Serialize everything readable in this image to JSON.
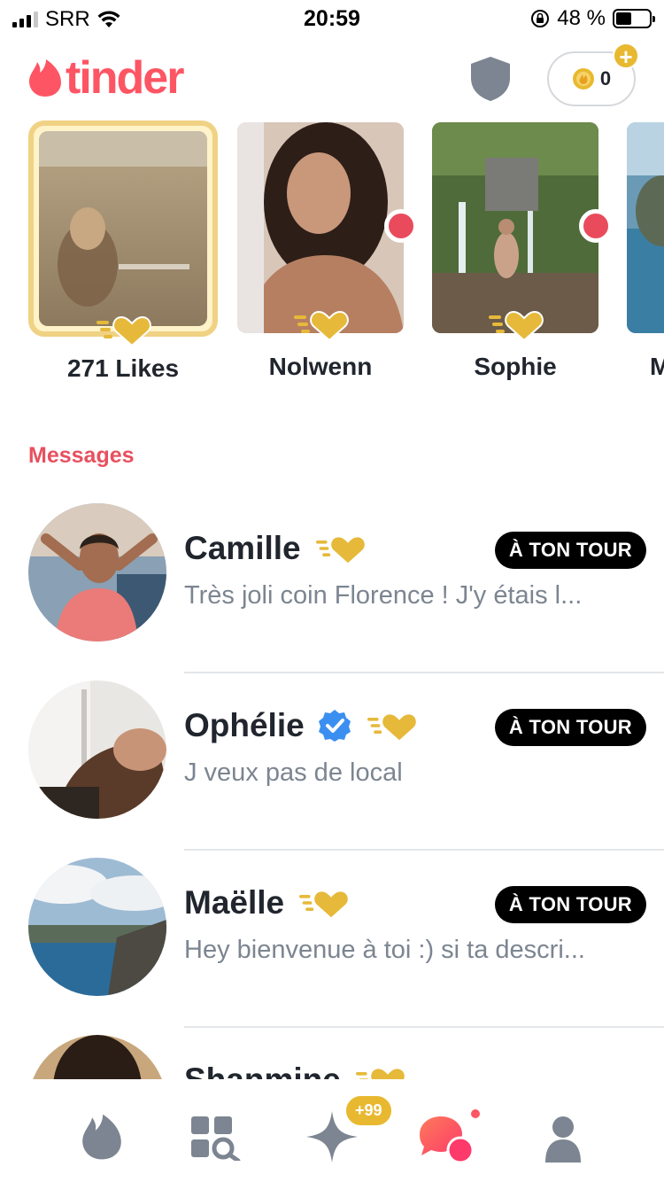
{
  "status_bar": {
    "carrier": "SRR",
    "time": "20:59",
    "battery": "48 %"
  },
  "header": {
    "logo": "tinder",
    "coins": "0"
  },
  "likes_row": [
    {
      "label": "271 Likes"
    },
    {
      "label": "Nolwenn"
    },
    {
      "label": "Sophie"
    },
    {
      "label": "M"
    }
  ],
  "messages": {
    "title": "Messages",
    "items": [
      {
        "name": "Camille",
        "preview": "Très joli coin Florence ! J'y étais l...",
        "badge": "À TON TOUR"
      },
      {
        "name": "Ophélie",
        "preview": "J veux pas de local",
        "badge": "À TON TOUR"
      },
      {
        "name": "Maëlle",
        "preview": "Hey bienvenue à toi :) si ta descri...",
        "badge": "À TON TOUR"
      },
      {
        "name": "Shanmine"
      }
    ]
  },
  "tab_bar": {
    "gold_badge": "+99"
  },
  "colors": {
    "brand": "#fd5564",
    "gold": "#e8b930",
    "text": "#21262e",
    "muted": "#7c8591"
  }
}
